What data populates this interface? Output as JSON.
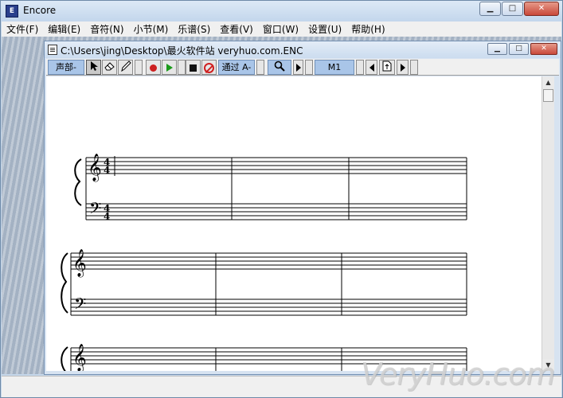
{
  "app": {
    "title": "Encore",
    "icon_text": "E"
  },
  "window_buttons": {
    "minimize": "▁",
    "maximize": "□",
    "close": "✕"
  },
  "menu": [
    {
      "label": "文件(F)"
    },
    {
      "label": "编辑(E)"
    },
    {
      "label": "音符(N)"
    },
    {
      "label": "小节(M)"
    },
    {
      "label": "乐谱(S)"
    },
    {
      "label": "查看(V)"
    },
    {
      "label": "窗口(W)"
    },
    {
      "label": "设置(U)"
    },
    {
      "label": "帮助(H)"
    }
  ],
  "document": {
    "title": "C:\\Users\\jing\\Desktop\\最火软件站 veryhuo.com.ENC"
  },
  "toolbar": {
    "voice_label": "声部-",
    "pass_label": "通过 A-",
    "measure_label": "M1"
  },
  "score": {
    "systems": [
      {
        "time_signature": [
          "4",
          "4"
        ],
        "measures": 3
      },
      {
        "time_signature": null,
        "measures": 3
      },
      {
        "time_signature": null,
        "measures": 3
      }
    ]
  },
  "watermark": "VeryHuo.com"
}
